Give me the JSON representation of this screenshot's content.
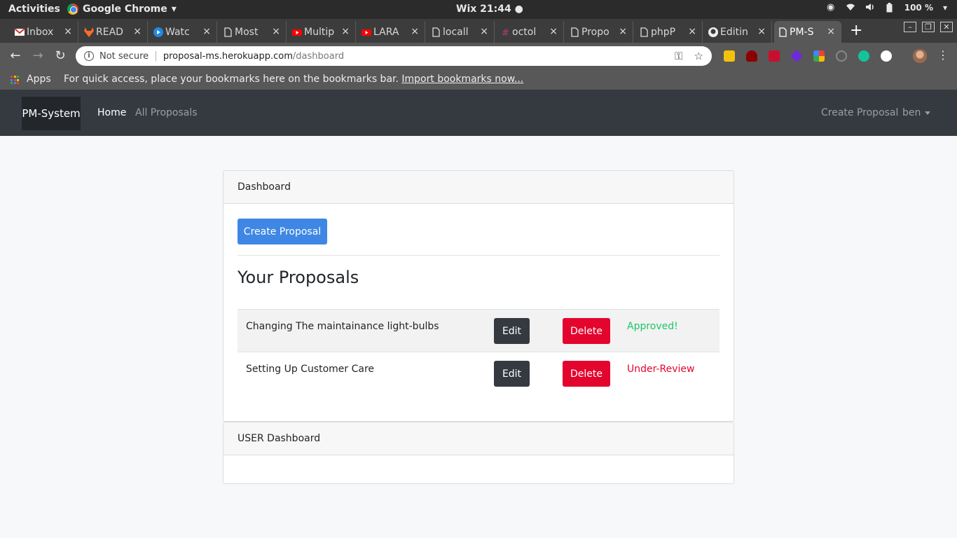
{
  "os": {
    "activities": "Activities",
    "app_name": "Google Chrome",
    "clock": "Wix 21:44 ●",
    "battery": "100 %"
  },
  "tabs": [
    {
      "title": "Inbox",
      "icon": "gmail-icon"
    },
    {
      "title": "READ",
      "icon": "gitlab-icon"
    },
    {
      "title": "Watc",
      "icon": "play-icon"
    },
    {
      "title": "Most",
      "icon": "page-icon"
    },
    {
      "title": "Multip",
      "icon": "youtube-icon"
    },
    {
      "title": "LARA",
      "icon": "youtube-icon"
    },
    {
      "title": "locall",
      "icon": "page-icon"
    },
    {
      "title": "octol",
      "icon": "slack-icon"
    },
    {
      "title": "Propo",
      "icon": "page-icon"
    },
    {
      "title": "phpP",
      "icon": "page-icon"
    },
    {
      "title": "Editin",
      "icon": "github-icon"
    },
    {
      "title": "PM-S",
      "icon": "page-icon"
    }
  ],
  "address_bar": {
    "security": "Not secure",
    "host": "proposal-ms.herokuapp.com",
    "path": "/dashboard"
  },
  "bookmarks": {
    "apps": "Apps",
    "hint": "For quick access, place your bookmarks here on the bookmarks bar.",
    "import": "Import bookmarks now..."
  },
  "navbar": {
    "brand": "PM-System",
    "home": "Home",
    "all_proposals": "All Proposals",
    "create_proposal": "Create Proposal",
    "user": "ben"
  },
  "dashboard": {
    "header": "Dashboard",
    "create_button": "Create Proposal",
    "section_title": "Your Proposals",
    "proposals": [
      {
        "title": "Changing The maintainance light-bulbs",
        "edit": "Edit",
        "delete": "Delete",
        "status": "Approved!",
        "status_color": "#1fc46a"
      },
      {
        "title": "Setting Up Customer Care",
        "edit": "Edit",
        "delete": "Delete",
        "status": "Under-Review",
        "status_color": "#e3052e"
      }
    ]
  },
  "user_dashboard": {
    "header": "USER Dashboard"
  },
  "colors": {
    "navbar": "#343a40",
    "primary": "#3f87e4",
    "danger": "#e3052e",
    "dark": "#343a40"
  }
}
